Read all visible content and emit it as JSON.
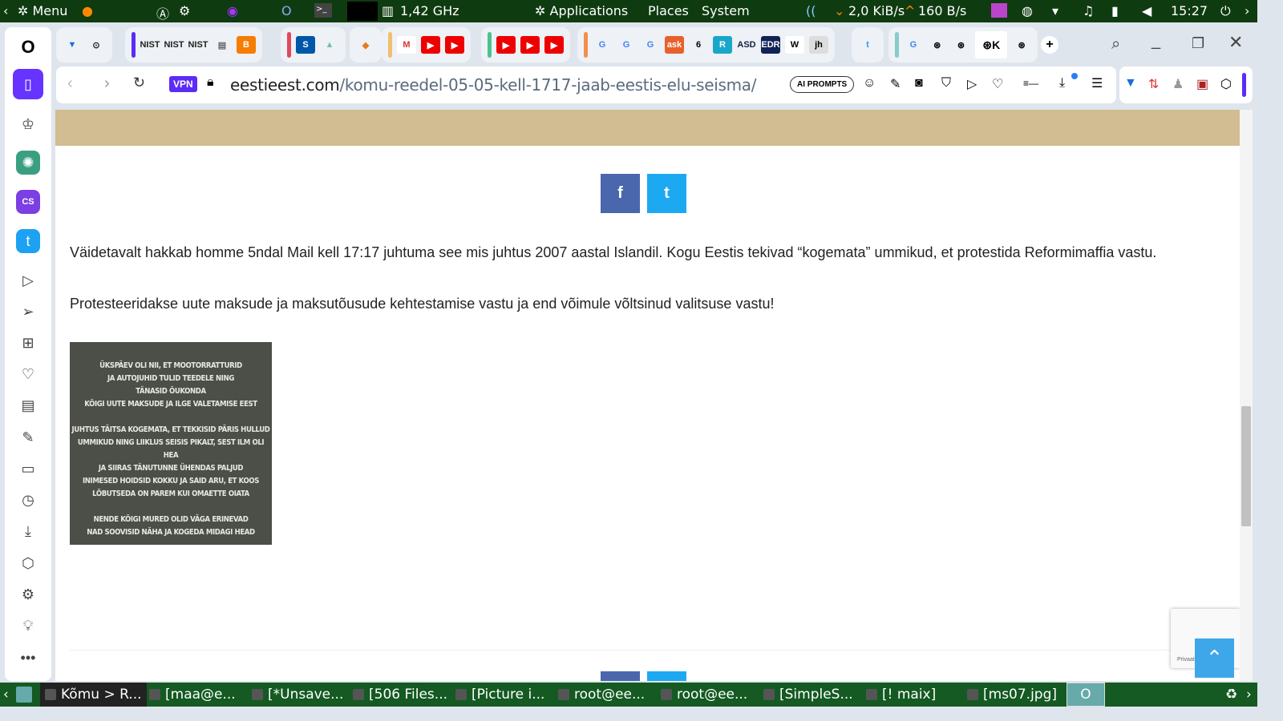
{
  "top_panel": {
    "menu": "Menu",
    "cpu": "1,42 GHz",
    "applications": "Applications",
    "places": "Places",
    "system": "System",
    "net_down": "2,0 KiB/s",
    "net_up": "160 B/s",
    "clock": "15:27"
  },
  "browser": {
    "tab_groups": [
      [
        "Vivaldi",
        "GitHub"
      ],
      [
        "NIST",
        "NIST",
        "NIST",
        "Doc",
        "Blogger"
      ],
      [
        "S",
        "Mountain"
      ],
      [
        "MetaMask"
      ],
      [
        "Gmail",
        "YouTube",
        "YouTube"
      ],
      [
        "YouTube",
        "YouTube",
        "YouTube"
      ],
      [
        "Google",
        "Google",
        "Google",
        "ask",
        "6",
        "R",
        "ASD News",
        "EDR",
        "W",
        "jh"
      ],
      [
        "Twitter"
      ],
      [
        "Google",
        "Dribbble",
        "Dribbble",
        "Dribbble",
        "Dribbble"
      ]
    ],
    "active_tab_label": "K",
    "new_tab": "+",
    "url_domain": "eestieest.com",
    "url_path": "/komu-reedel-05-05-kell-1717-jaab-eestis-elu-seisma/",
    "vpn": "VPN",
    "ai_prompts": "AI PROMPTS"
  },
  "article": {
    "share_facebook": "f",
    "share_twitter": "t",
    "paragraph1": "Väidetavalt hakkab homme 5ndal Mail kell 17:17 juhtuma see mis juhtus 2007 aastal Islandil. Kogu Eestis tekivad “kogemata” ummikud, et protestida Reformimaffia vastu.",
    "paragraph2": "Protesteeridakse uute maksude ja maksutõusude kehtestamise vastu ja end võimule võltsinud valitsuse vastu!",
    "poster_lines": [
      [
        "ÜKSPÄEV OLI NII, ET MOOTORRATTURID",
        "JA AUTOJUHID TULID TEEDELE NING",
        "TÄNASID ÕUKONDA",
        "KÕIGI UUTE MAKSUDE JA ILGE VALETAMISE EEST"
      ],
      [
        "JUHTUS TÄITSA  KOGEMATA, ET TEKKISID PÄRIS HULLUD",
        "UMMIKUD NING LIIKLUS SEISIS PIKALT, SEST ILM OLI HEA",
        "JA SIIRAS TÄNUTUNNE ÜHENDAS PALJUD",
        "INIMESED HOIDSID KOKKU JA SAID ARU, ET KOOS",
        "LÕBUTSEDA ON PAREM KUI OMAETTE OIATA"
      ],
      [
        "NENDE KÕIGI MURED OLID VÄGA ERINEVAD",
        "NAD SOOVISID NÄHA JA KOGEDA MIDAGI HEAD"
      ]
    ],
    "recaptcha": "Privaatsus"
  },
  "taskbar": [
    "Kõmu > R...",
    "[maa@e...",
    "[*Unsave...",
    "[506 Files...",
    "[Picture i...",
    "root@ee...",
    "root@ee...",
    "[SimpleS...",
    "[! maix]",
    "[ms07.jpg]"
  ]
}
